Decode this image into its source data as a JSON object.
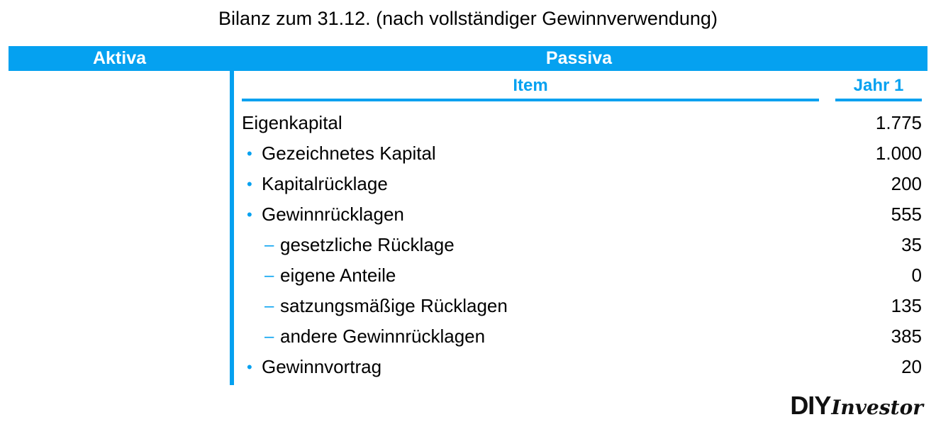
{
  "title": "Bilanz zum 31.12. (nach vollständiger Gewinnverwendung)",
  "colors": {
    "accent_blue": "#05A1F0",
    "text_black": "#000000",
    "band_text": "#FFFFFF"
  },
  "band": {
    "aktiva_label": "Aktiva",
    "passiva_label": "Passiva"
  },
  "table": {
    "columns": {
      "item": "Item",
      "value": "Jahr 1"
    },
    "rows": [
      {
        "level": 1,
        "marker": "",
        "label": "Eigenkapital",
        "value": "1.775"
      },
      {
        "level": 2,
        "marker": "•",
        "label": "Gezeichnetes Kapital",
        "value": "1.000"
      },
      {
        "level": 2,
        "marker": "•",
        "label": "Kapitalrücklage",
        "value": "200"
      },
      {
        "level": 2,
        "marker": "•",
        "label": "Gewinnrücklagen",
        "value": "555"
      },
      {
        "level": 3,
        "marker": "–",
        "label": "gesetzliche Rücklage",
        "value": "35"
      },
      {
        "level": 3,
        "marker": "–",
        "label": "eigene Anteile",
        "value": "0"
      },
      {
        "level": 3,
        "marker": "–",
        "label": "satzungsmäßige Rücklagen",
        "value": "135"
      },
      {
        "level": 3,
        "marker": "–",
        "label": "andere Gewinnrücklagen",
        "value": "385"
      },
      {
        "level": 2,
        "marker": "•",
        "label": "Gewinnvortrag",
        "value": "20"
      }
    ]
  },
  "logo": {
    "primary": "DIY",
    "secondary": "Investor"
  }
}
